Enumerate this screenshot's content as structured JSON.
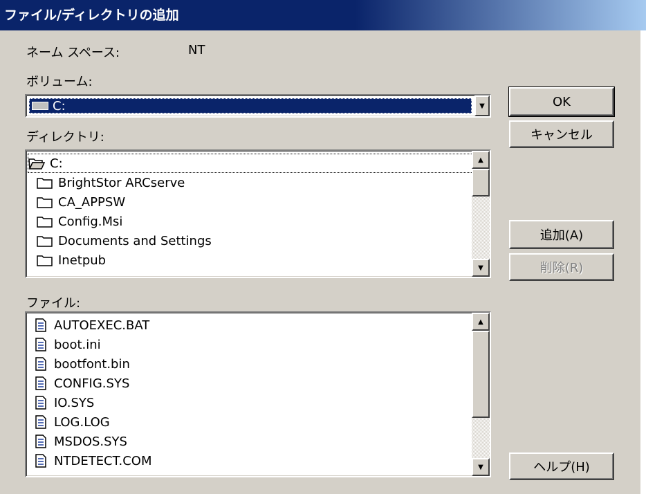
{
  "window": {
    "title": "ファイル/ディレクトリの追加"
  },
  "namespace": {
    "label": "ネーム スペース:",
    "value": "NT"
  },
  "volume": {
    "label": "ボリューム:",
    "selected": "C:",
    "icon": "drive-icon"
  },
  "directory": {
    "label": "ディレクトリ:",
    "items": [
      {
        "name": "C:",
        "icon": "open-folder-icon"
      },
      {
        "name": "BrightStor ARCserve",
        "icon": "folder-icon"
      },
      {
        "name": "CA_APPSW",
        "icon": "folder-icon"
      },
      {
        "name": "Config.Msi",
        "icon": "folder-icon"
      },
      {
        "name": "Documents and Settings",
        "icon": "folder-icon"
      },
      {
        "name": "Inetpub",
        "icon": "folder-icon"
      }
    ]
  },
  "files": {
    "label": "ファイル:",
    "items": [
      {
        "name": "AUTOEXEC.BAT",
        "icon": "file-icon"
      },
      {
        "name": "boot.ini",
        "icon": "file-icon"
      },
      {
        "name": "bootfont.bin",
        "icon": "file-icon"
      },
      {
        "name": "CONFIG.SYS",
        "icon": "file-icon"
      },
      {
        "name": "IO.SYS",
        "icon": "file-icon"
      },
      {
        "name": "LOG.LOG",
        "icon": "file-icon"
      },
      {
        "name": "MSDOS.SYS",
        "icon": "file-icon"
      },
      {
        "name": "NTDETECT.COM",
        "icon": "file-icon"
      }
    ]
  },
  "buttons": {
    "ok": "OK",
    "cancel": "キャンセル",
    "add": "追加(A)",
    "remove": "削除(R)",
    "help": "ヘルプ(H)"
  },
  "colors": {
    "title_bar": "#0a246a",
    "selection": "#0a246a",
    "face": "#d4d0c8"
  }
}
